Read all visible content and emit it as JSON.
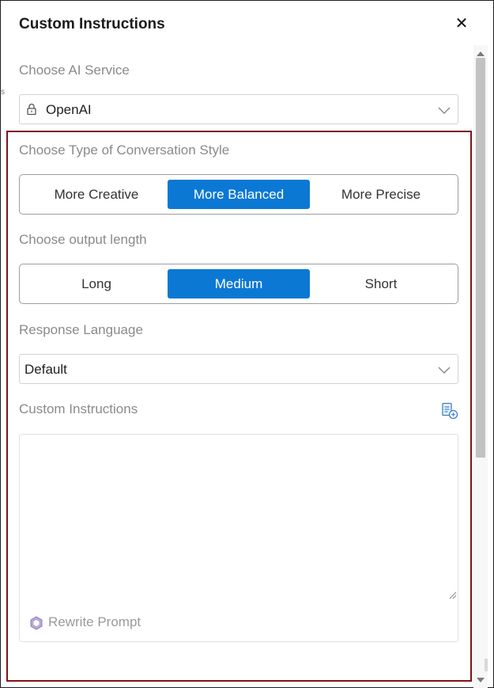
{
  "panel": {
    "title": "Custom Instructions",
    "close_symbol": "✕"
  },
  "ai_service": {
    "label": "Choose AI Service",
    "selected": "OpenAI",
    "icon": "lock-icon"
  },
  "conversation_style": {
    "label": "Choose Type of Conversation Style",
    "options": [
      "More Creative",
      "More Balanced",
      "More Precise"
    ],
    "selected": "More Balanced"
  },
  "output_length": {
    "label": "Choose output length",
    "options": [
      "Long",
      "Medium",
      "Short"
    ],
    "selected": "Medium"
  },
  "response_language": {
    "label": "Response Language",
    "selected": "Default"
  },
  "custom_instructions": {
    "label": "Custom Instructions",
    "value": "",
    "rewrite_label": "Rewrite Prompt"
  },
  "colors": {
    "accent": "#0b78d4",
    "highlight_border": "#7e1418",
    "label_gray": "#8a8a8a"
  }
}
